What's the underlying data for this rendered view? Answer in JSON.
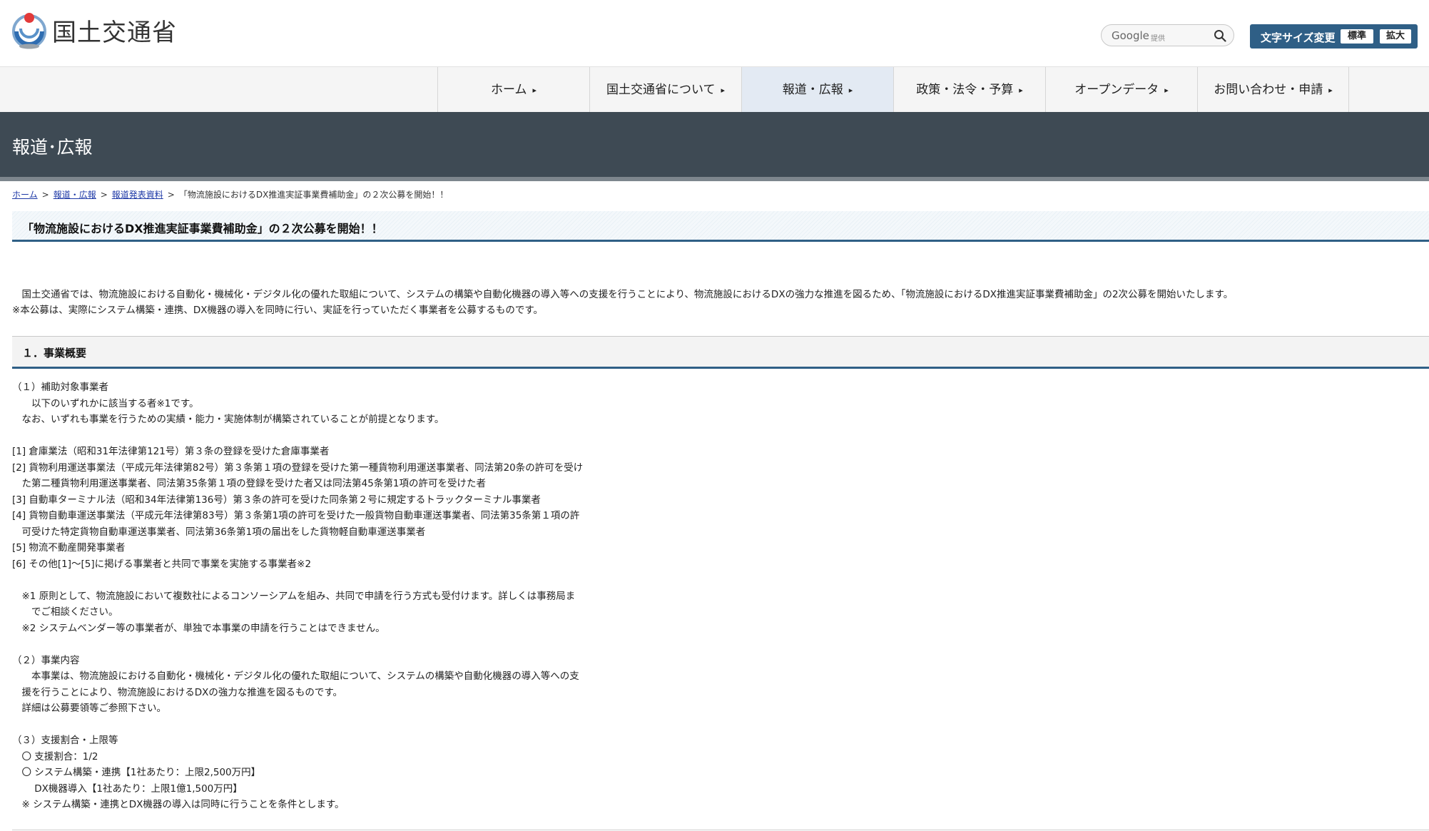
{
  "header": {
    "logo_text": "国土交通省",
    "search": {
      "brand": "Google",
      "sub": "提供"
    },
    "font_size": {
      "label": "文字サイズ変更",
      "standard": "標準",
      "large": "拡大"
    }
  },
  "nav": [
    {
      "label": "ホーム"
    },
    {
      "label": "国土交通省について"
    },
    {
      "label": "報道・広報"
    },
    {
      "label": "政策・法令・予算"
    },
    {
      "label": "オープンデータ"
    },
    {
      "label": "お問い合わせ・申請"
    }
  ],
  "nav_arrow": "▸",
  "banner_title": "報道･広報",
  "breadcrumb": {
    "items": [
      "ホーム",
      "報道・広報",
      "報道発表資料"
    ],
    "current": "「物流施設におけるDX推進実証事業費補助金」の２次公募を開始！！",
    "sep": ">"
  },
  "page_title": "「物流施設におけるDX推進実証事業費補助金」の２次公募を開始！！",
  "lead": [
    "　国土交通省では、物流施設における自動化・機械化・デジタル化の優れた取組について、システムの構築や自動化機器の導入等への支援を行うことにより、物流施設におけるDXの強力な推進を図るため、「物流施設におけるDX推進実証事業費補助金」の2次公募を開始いたします。",
    "※本公募は、実際にシステム構築・連携、DX機器の導入を同時に行い、実証を行っていただく事業者を公募するものです。"
  ],
  "section_title": "１．事業概要",
  "body_lines": [
    "（１）補助対象事業者",
    "　　以下のいずれかに該当する者※1です。",
    "　なお、いずれも事業を行うための実績・能力・実施体制が構築されていることが前提となります。",
    "",
    "[1] 倉庫業法（昭和31年法律第121号）第３条の登録を受けた倉庫事業者",
    "[2] 貨物利用運送事業法（平成元年法律第82号）第３条第１項の登録を受けた第一種貨物利用運送事業者、同法第20条の許可を受け",
    "　た第二種貨物利用運送事業者、同法第35条第１項の登録を受けた者又は同法第45条第1項の許可を受けた者",
    "[3] 自動車ターミナル法（昭和34年法律第136号）第３条の許可を受けた同条第２号に規定するトラックターミナル事業者",
    "[4] 貨物自動車運送事業法（平成元年法律第83号）第３条第1項の許可を受けた一般貨物自動車運送事業者、同法第35条第１項の許",
    "　可受けた特定貨物自動車運送事業者、同法第36条第1項の届出をした貨物軽自動車運送事業者",
    "[5] 物流不動産開発事業者",
    "[6] その他[1]～[5]に掲げる事業者と共同で事業を実施する事業者※2",
    "",
    "　※1 原則として、物流施設において複数社によるコンソーシアムを組み、共同で申請を行う方式も受付けます。詳しくは事務局ま",
    "　　でご相談ください。",
    "　※2 システムベンダー等の事業者が、単独で本事業の申請を行うことはできません。",
    "",
    "（２）事業内容",
    "　　本事業は、物流施設における自動化・機械化・デジタル化の優れた取組について、システムの構築や自動化機器の導入等への支",
    "　援を行うことにより、物流施設におけるDXの強力な推進を図るものです。",
    "　詳細は公募要領等ご参照下さい。",
    "",
    "（３）支援割合・上限等",
    "　〇 支援割合：1/2",
    "　〇 システム構築・連携【1社あたり：上限2,500万円】",
    "　　 DX機器導入【1社あたり：上限1億1,500万円】",
    "　※ システム構築・連携とDX機器の導入は同時に行うことを条件とします。"
  ],
  "colors": {
    "banner_bg": "#3e4a54",
    "accent": "#2f5f86",
    "nav_active": "#e3eaf3"
  }
}
